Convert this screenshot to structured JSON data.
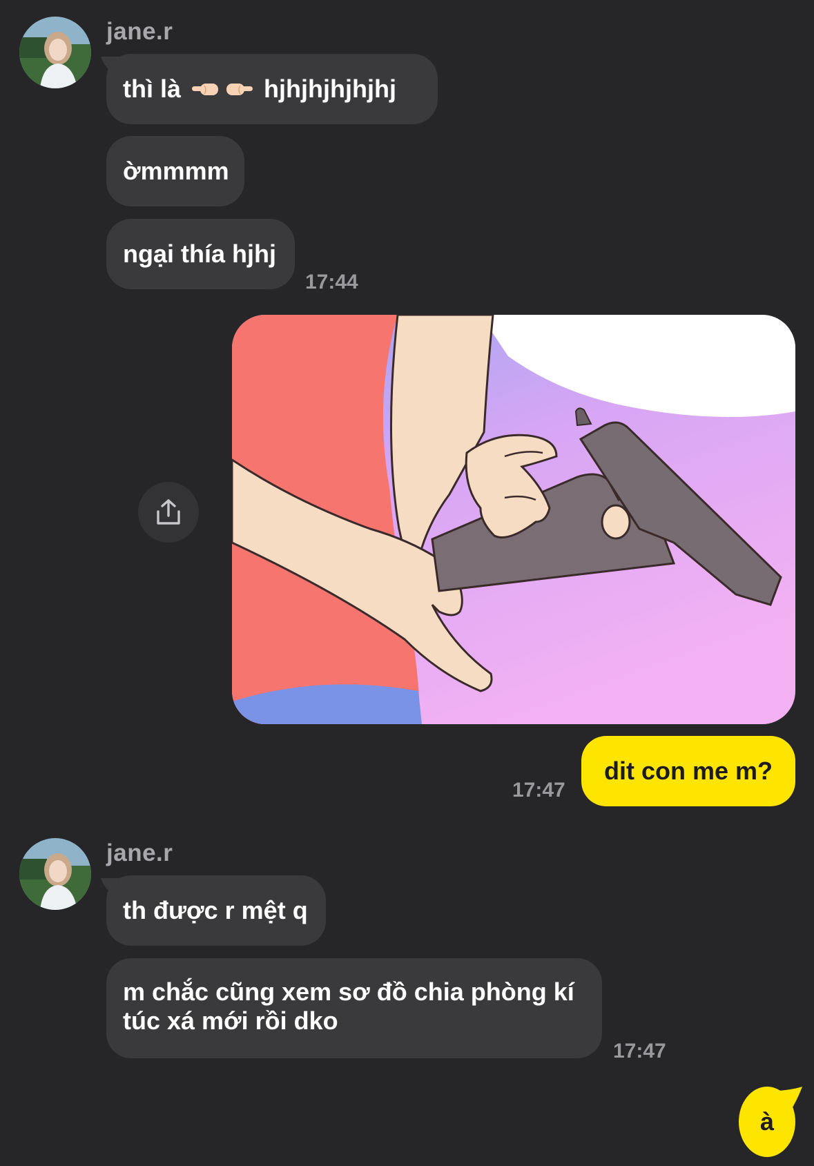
{
  "conversation": {
    "group1": {
      "sender": "jane.r",
      "messages": [
        {
          "text_before": "thì là",
          "text_after": "hjhjhjhjhjhj",
          "emoji": [
            "backhand-index-pointing-left",
            "backhand-index-pointing-right"
          ]
        },
        {
          "text": "ờmmmm"
        },
        {
          "text": "ngại thía hjhj"
        }
      ],
      "time": "17:44"
    },
    "sent1": {
      "image": "cartoon-hands-with-pistol",
      "message": "dit con me m?",
      "time": "17:47"
    },
    "group2": {
      "sender": "jane.r",
      "messages": [
        {
          "text": "th được r mệt q"
        },
        {
          "text": "m chắc cũng xem sơ đồ chia phòng kí túc xá mới rồi dko"
        }
      ],
      "time": "17:47"
    },
    "sent2": {
      "message": "à"
    }
  },
  "icons": {
    "share": "share-icon"
  },
  "colors": {
    "background": "#262628",
    "incoming_bubble": "#3a3a3c",
    "outgoing_bubble": "#fee500",
    "timestamp": "#98989d",
    "sender_name": "#a8a8ac"
  }
}
